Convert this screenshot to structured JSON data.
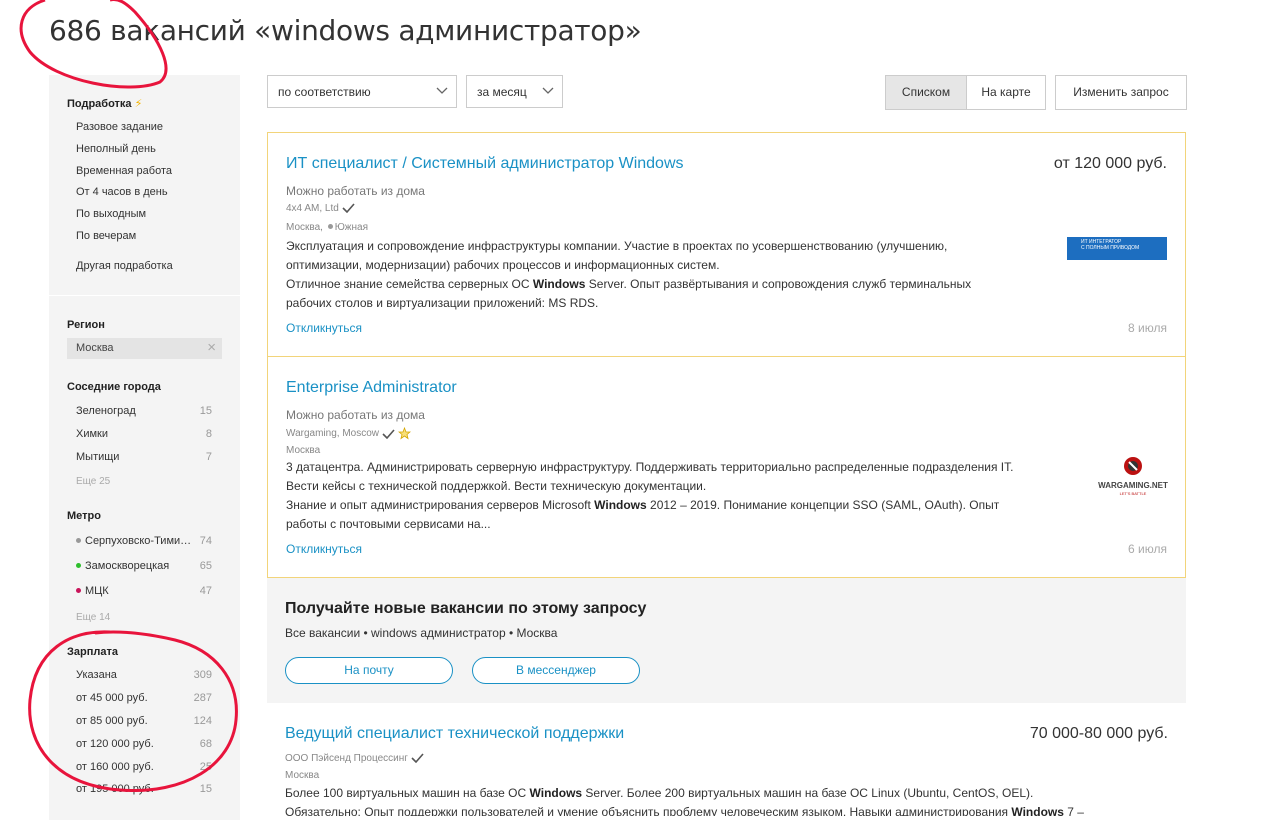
{
  "header": {
    "title": "686 вакансий «windows администратор»"
  },
  "sidebar": {
    "podrabotka": {
      "heading": "Подработка",
      "items": [
        "Разовое задание",
        "Неполный день",
        "Временная работа",
        "От 4 часов в день",
        "По выходным",
        "По вечерам",
        "Другая подработка"
      ]
    },
    "region": {
      "heading": "Регион",
      "value": "Москва"
    },
    "nearby": {
      "heading": "Соседние города",
      "items": [
        {
          "label": "Зеленоград",
          "count": "15"
        },
        {
          "label": "Химки",
          "count": "8"
        },
        {
          "label": "Мытищи",
          "count": "7"
        }
      ],
      "more": "Еще 25"
    },
    "metro": {
      "heading": "Метро",
      "items": [
        {
          "label": "Серпуховско-Тими…",
          "count": "74",
          "color": "#999999"
        },
        {
          "label": "Замоскворецкая",
          "count": "65",
          "color": "#2dbe2c"
        },
        {
          "label": "МЦК",
          "count": "47",
          "color": "#c9145a"
        }
      ],
      "more": "Еще 14"
    },
    "salary": {
      "heading": "Зарплата",
      "items": [
        {
          "label": "Указана",
          "count": "309"
        },
        {
          "label": "от 45 000 руб.",
          "count": "287"
        },
        {
          "label": "от 85 000 руб.",
          "count": "124"
        },
        {
          "label": "от 120 000 руб.",
          "count": "68"
        },
        {
          "label": "от 160 000 руб.",
          "count": "25"
        },
        {
          "label": "от 195 000 руб.",
          "count": "15"
        }
      ]
    }
  },
  "toolbar": {
    "sort": "по соответствию",
    "period": "за месяц",
    "view_list": "Списком",
    "view_map": "На карте",
    "edit_query": "Изменить запрос"
  },
  "vacancies": [
    {
      "title": "ИТ специалист / Системный администратор Windows",
      "salary": "от 120 000 руб.",
      "remote": "Можно работать из дома",
      "company": "4x4 AM, Ltd",
      "location": "Москва,",
      "metro": "Южная",
      "desc1a": "Эксплуатация и сопровождение инфраструктуры компании. Участие в проектах по усовершенствованию (улучшению,",
      "desc1b": "оптимизации, модернизации) рабочих процессов и информационных систем.",
      "desc2a": "Отличное знание семейства серверных ОС ",
      "desc2b": "Windows",
      "desc2c": " Server. Опыт развёртывания и сопровождения служб терминальных",
      "desc2d": "рабочих столов и виртуализации приложений: MS RDS.",
      "respond": "Откликнуться",
      "date": "8 июля",
      "logo_line1": "ИТ ИНТЕГРАТОР",
      "logo_line2": "С ПОЛНЫМ ПРИВОДОМ",
      "logo_color": "#1d6ec0"
    },
    {
      "title": "Enterprise Administrator",
      "remote": "Можно работать из дома",
      "company": "Wargaming, Moscow",
      "location": "Москва",
      "desc1a": "3 датацентра. Администрировать серверную инфраструктуру. Поддерживать территориально распределенные подразделения IT.",
      "desc1b": "Вести кейсы с технической поддержкой. Вести техническую документации.",
      "desc2a": "Знание и опыт администрирования серверов Microsoft ",
      "desc2b": "Windows",
      "desc2c": " 2012 – 2019. Понимание концепции SSO (SAML, OAuth). Опыт",
      "desc2d": "работы с почтовыми сервисами на...",
      "respond": "Откликнуться",
      "date": "6 июля",
      "logo_text": "WARGAMING.NET",
      "logo_sub": "LET'S BATTLE"
    },
    {
      "title": "Ведущий специалист технической поддержки",
      "salary": "70 000-80 000 руб.",
      "company": "ООО Пэйсенд Процессинг",
      "location": "Москва",
      "desc1a": "Более 100 виртуальных машин на базе ОС ",
      "desc1b": "Windows",
      "desc1c": " Server. Более 200 виртуальных машин на базе ОС Linux (Ubuntu, CentOS, OEL).",
      "desc2a": "Обязательно: Опыт поддержки пользователей и умение объяснить проблему человеческим языком. Навыки администрирования ",
      "desc2b": "Windows",
      "desc2c": " 7 –"
    }
  ],
  "subscribe": {
    "title": "Получайте новые вакансии по этому запросу",
    "desc": "Все вакансии • windows администратор • Москва",
    "email_button": "На почту",
    "messenger_button": "В мессенджер"
  },
  "colors": {
    "link": "#1a91c5",
    "premium_border": "#f2d47a",
    "annotation": "#e8143c"
  }
}
